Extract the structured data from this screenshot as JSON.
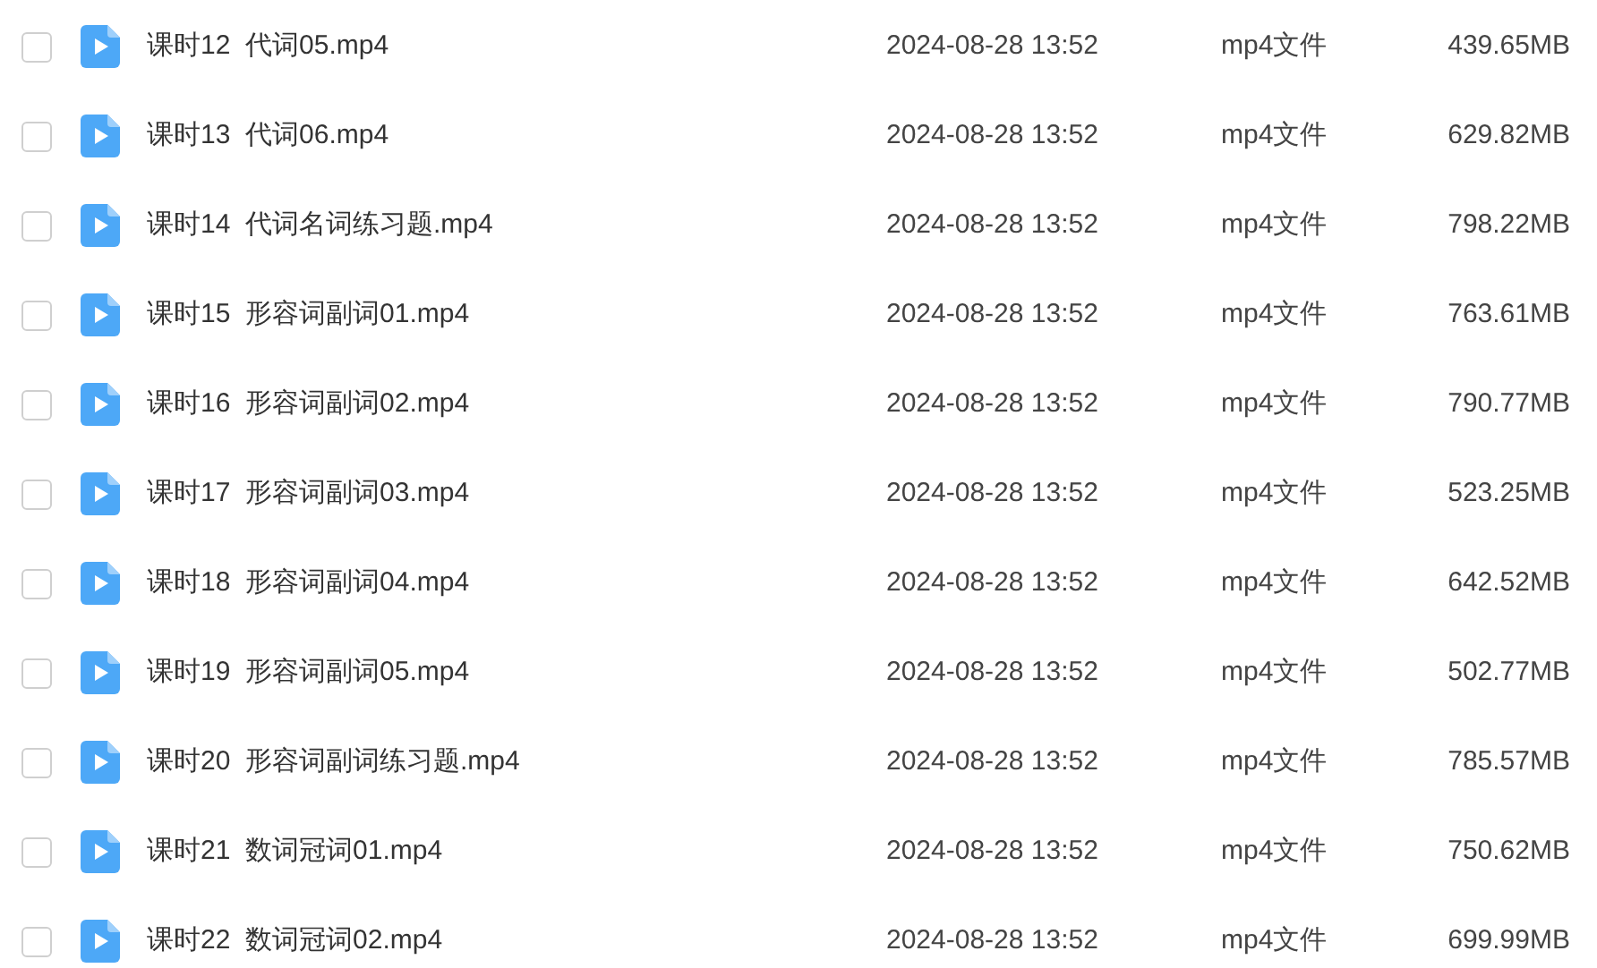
{
  "files": [
    {
      "name": "课时12  代词05.mp4",
      "date": "2024-08-28 13:52",
      "type": "mp4文件",
      "size": "439.65MB",
      "checked": false
    },
    {
      "name": "课时13  代词06.mp4",
      "date": "2024-08-28 13:52",
      "type": "mp4文件",
      "size": "629.82MB",
      "checked": false
    },
    {
      "name": "课时14  代词名词练习题.mp4",
      "date": "2024-08-28 13:52",
      "type": "mp4文件",
      "size": "798.22MB",
      "checked": false
    },
    {
      "name": "课时15  形容词副词01.mp4",
      "date": "2024-08-28 13:52",
      "type": "mp4文件",
      "size": "763.61MB",
      "checked": false
    },
    {
      "name": "课时16  形容词副词02.mp4",
      "date": "2024-08-28 13:52",
      "type": "mp4文件",
      "size": "790.77MB",
      "checked": false
    },
    {
      "name": "课时17  形容词副词03.mp4",
      "date": "2024-08-28 13:52",
      "type": "mp4文件",
      "size": "523.25MB",
      "checked": false
    },
    {
      "name": "课时18  形容词副词04.mp4",
      "date": "2024-08-28 13:52",
      "type": "mp4文件",
      "size": "642.52MB",
      "checked": false
    },
    {
      "name": "课时19  形容词副词05.mp4",
      "date": "2024-08-28 13:52",
      "type": "mp4文件",
      "size": "502.77MB",
      "checked": false
    },
    {
      "name": "课时20  形容词副词练习题.mp4",
      "date": "2024-08-28 13:52",
      "type": "mp4文件",
      "size": "785.57MB",
      "checked": false
    },
    {
      "name": "课时21  数词冠词01.mp4",
      "date": "2024-08-28 13:52",
      "type": "mp4文件",
      "size": "750.62MB",
      "checked": false
    },
    {
      "name": "课时22  数词冠词02.mp4",
      "date": "2024-08-28 13:52",
      "type": "mp4文件",
      "size": "699.99MB",
      "checked": false
    }
  ]
}
